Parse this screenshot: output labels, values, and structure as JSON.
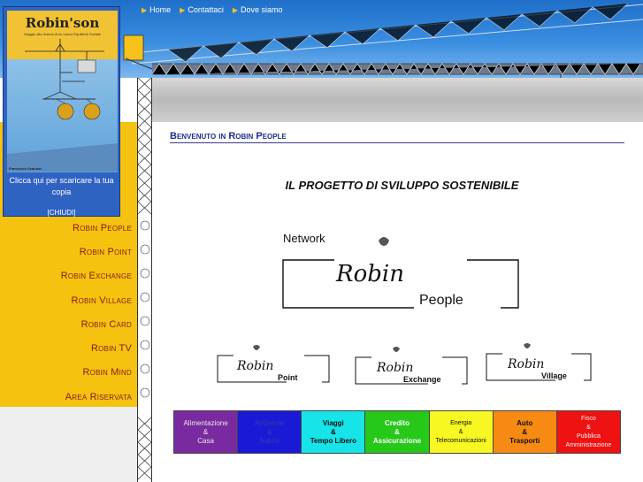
{
  "topnav": {
    "items": [
      {
        "label": "Home"
      },
      {
        "label": "Contattaci"
      },
      {
        "label": "Dove siamo"
      }
    ]
  },
  "popup": {
    "title": "Robin'son",
    "subtitle": "Viaggio alla ricerca di un nuovo Equilibrio Sociale",
    "author": "Francesco Scaluzzi",
    "download_text": "Clicca qui per scaricare la tua copia",
    "close_label": "[CHIUDI]"
  },
  "menu": {
    "items": [
      {
        "label": "Robin People"
      },
      {
        "label": "Robin Point"
      },
      {
        "label": "Robin Exchange"
      },
      {
        "label": "Robin Village"
      },
      {
        "label": "Robin Card"
      },
      {
        "label": "Robin TV"
      },
      {
        "label": "Robin Mind"
      },
      {
        "label": "Area Riservata"
      }
    ]
  },
  "main": {
    "welcome": "Benvenuto in Robin People",
    "project_title": "IL PROGETTO DI SVILUPPO SOSTENIBILE",
    "logo_big": {
      "top": "Network",
      "script": "Robin",
      "bottom": "People"
    },
    "logos_small": [
      {
        "script": "Robin",
        "label": "Point"
      },
      {
        "script": "Robin",
        "label": "Exchange"
      },
      {
        "script": "Robin",
        "label": "Village"
      }
    ]
  },
  "categories": [
    {
      "line1": "Alimentazione",
      "line2": "&",
      "line3": "Casa",
      "bg": "#7a2aa0",
      "fg": "#e8e8e8"
    },
    {
      "line1": "Ambiente",
      "line2": "&",
      "line3": "Salute",
      "bg": "#1a1ad6",
      "fg": "#3a3ab0"
    },
    {
      "line1": "Viaggi",
      "line2": "&",
      "line3": "Tempo Libero",
      "bg": "#16e4e8",
      "fg": "#111111"
    },
    {
      "line1": "Credito",
      "line2": "&",
      "line3": "Assicurazione",
      "bg": "#26c81a",
      "fg": "#ffffff"
    },
    {
      "line1": "Energia",
      "line2": "&",
      "line3": "Telecomunicazioni",
      "bg": "#f7f722",
      "fg": "#111111"
    },
    {
      "line1": "Auto",
      "line2": "&",
      "line3": "Trasporti",
      "bg": "#f78a12",
      "fg": "#111111"
    },
    {
      "line1": "Fisco",
      "line2": "&",
      "line3": "Pubblica Amministrazione",
      "bg": "#ee1212",
      "fg": "#f3f3f3"
    }
  ]
}
